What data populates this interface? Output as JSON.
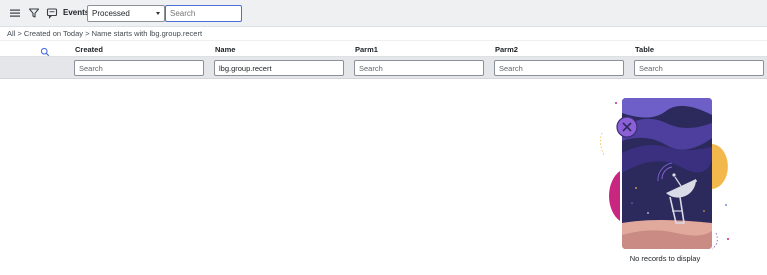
{
  "toolbar": {
    "menu_icon": "hamburger-icon",
    "filter_icon": "funnel-icon",
    "context_icon": "comment-icon",
    "title": "Events",
    "state_select": {
      "value": "Processed"
    },
    "search": {
      "placeholder": "Search"
    }
  },
  "breadcrumb": {
    "items": [
      "All",
      "Created on Today",
      "Name starts with lbg.group.recert"
    ],
    "separator": ">"
  },
  "table": {
    "columns": [
      "Created",
      "Name",
      "Parm1",
      "Parm2",
      "Table"
    ],
    "filters": [
      {
        "value": "",
        "placeholder": "Search"
      },
      {
        "value": "lbg.group.recert",
        "placeholder": "Search"
      },
      {
        "value": "",
        "placeholder": "Search"
      },
      {
        "value": "",
        "placeholder": "Search"
      },
      {
        "value": "",
        "placeholder": "Search"
      }
    ]
  },
  "empty_state": {
    "message": "No records to display",
    "illustration": "satellite-dish-illustration"
  },
  "colors": {
    "accent": "#4d6fd8",
    "toolbar_bg": "#eef0f2",
    "filter_row_bg": "#e4e6e9",
    "illustration_sky": "#2c2a5c",
    "illustration_purple": "#8b5fd6",
    "illustration_pink": "#c8267f",
    "illustration_yellow": "#f2b84b"
  }
}
